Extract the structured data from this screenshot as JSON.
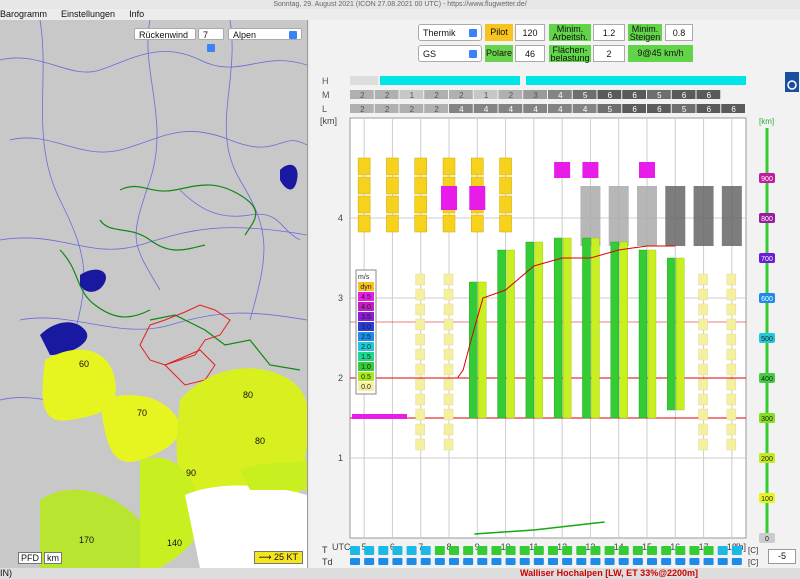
{
  "window": {
    "title": "Sonntag, 29. August 2021 (ICON 27.08.2021 00 UTC) - https://www.flugwetter.de/"
  },
  "menu": [
    {
      "label": "Barogramm"
    },
    {
      "label": "Einstellungen"
    },
    {
      "label": "Info"
    }
  ],
  "map_controls": {
    "wind_label": "Rückenwind",
    "wind_value": "7",
    "region": "Alpen"
  },
  "map_labels": {
    "l60": "60",
    "l70": "70",
    "l80a": "80",
    "l80b": "80",
    "l90": "90",
    "l140": "140",
    "l170": "170"
  },
  "pfd": {
    "a": "PFD",
    "b": "km"
  },
  "wind_legend": "25 KT",
  "status": {
    "left": "IN)",
    "center": "Walliser Hochalpen [LW, ET  33%@2200m]"
  },
  "controls": {
    "mode": "Thermik",
    "pilot_label": "Pilot",
    "pilot_value": "120",
    "min_arbeit_label": "Minim. Arbeitsh.",
    "min_arbeit_value": "1.2",
    "min_steigen_label": "Minim. Steigen",
    "min_steigen_value": "0.8",
    "glider": "GS",
    "polare_label": "Polare",
    "polare_value": "46",
    "flaechen_label": "Flächen- belastung",
    "flaechen_value": "2",
    "result": "9@45 km/h"
  },
  "td_value": "-5",
  "colors": {
    "yellow": "#f7d21c",
    "magenta": "#e81ce8",
    "green": "#33cc33",
    "lime": "#c8f020",
    "red": "#d00000",
    "cyan": "#00e5e5"
  },
  "chart_data": {
    "type": "table",
    "cloud_rows": {
      "H": "",
      "M": [
        "2",
        "2",
        "1",
        "2",
        "2",
        "1",
        "2",
        "3",
        "4",
        "5",
        "6",
        "6",
        "5",
        "6",
        "6"
      ],
      "L": [
        "2",
        "2",
        "2",
        "2",
        "4",
        "4",
        "4",
        "4",
        "4",
        "4",
        "5",
        "6",
        "6",
        "5",
        "6",
        "6"
      ]
    },
    "cloud_row_labels": [
      "H",
      "M",
      "L"
    ],
    "x_ticks": [
      "5",
      "6",
      "7",
      "8",
      "9",
      "10",
      "11",
      "12",
      "13",
      "14",
      "15",
      "16",
      "17",
      "18"
    ],
    "x_unit": "[h]",
    "x_label": "UTC",
    "y_left_unit": "[km]",
    "y_left_ticks": [
      "1",
      "2",
      "3",
      "4"
    ],
    "y_right_unit": "[km]",
    "y_right_ticks": [
      "0",
      "100",
      "200",
      "300",
      "400",
      "500",
      "600",
      "700",
      "800",
      "900"
    ],
    "climb_legend_title": "m/s",
    "climb_legend": [
      {
        "label": "dyn",
        "color": "#f7c31c"
      },
      {
        "label": "4.5",
        "color": "#e81ce8"
      },
      {
        "label": "4.0",
        "color": "#c41cc4"
      },
      {
        "label": "3.5",
        "color": "#8c1cd8"
      },
      {
        "label": "3.0",
        "color": "#2a3cd8"
      },
      {
        "label": "2.5",
        "color": "#1c8ce8"
      },
      {
        "label": "2.0",
        "color": "#1cc8d8"
      },
      {
        "label": "1.5",
        "color": "#1cd88c"
      },
      {
        "label": "1.0",
        "color": "#33cc33"
      },
      {
        "label": "0.5",
        "color": "#a8e81c"
      },
      {
        "label": "0.0",
        "color": "#f5f0a0"
      }
    ],
    "T_label": "T",
    "Td_label": "Td",
    "T_unit": "[C]",
    "Td_unit": "[C]"
  }
}
